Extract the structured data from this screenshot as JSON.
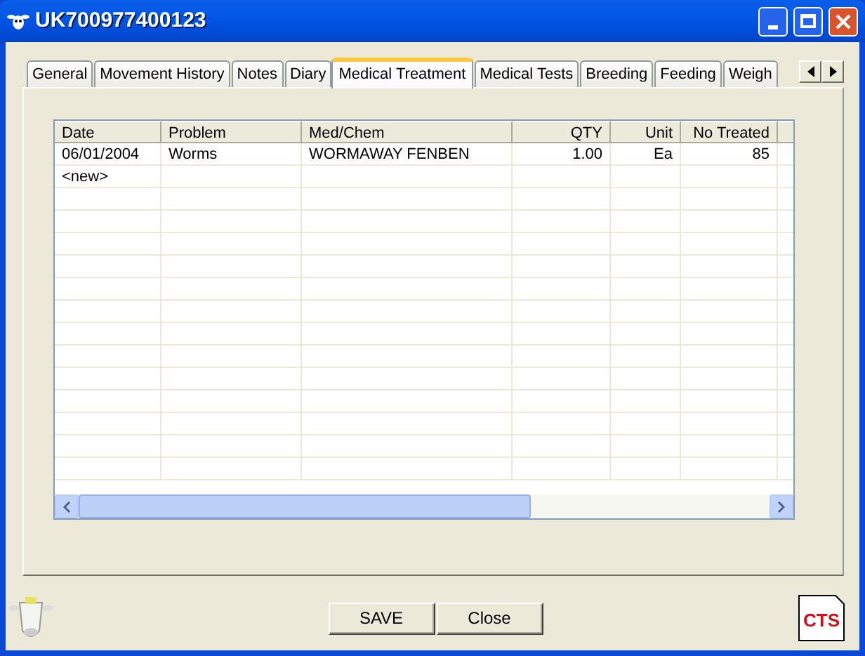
{
  "window": {
    "title": "UK700977400123"
  },
  "tabs": [
    {
      "label": "General",
      "selected": false
    },
    {
      "label": "Movement History",
      "selected": false
    },
    {
      "label": "Notes",
      "selected": false
    },
    {
      "label": "Diary",
      "selected": false
    },
    {
      "label": "Medical Treatment",
      "selected": true
    },
    {
      "label": "Medical Tests",
      "selected": false
    },
    {
      "label": "Breeding",
      "selected": false
    },
    {
      "label": "Feeding",
      "selected": false
    },
    {
      "label": "Weigh",
      "selected": false
    }
  ],
  "table": {
    "columns": [
      "Date",
      "Problem",
      "Med/Chem",
      "QTY",
      "Unit",
      "No Treated"
    ],
    "rows": [
      [
        "06/01/2004",
        "Worms",
        "WORMAWAY FENBEN",
        "1.00",
        "Ea",
        "85"
      ]
    ],
    "new_row": "<new>"
  },
  "buttons": [
    "SAVE",
    "Close"
  ],
  "logo": "CTS"
}
